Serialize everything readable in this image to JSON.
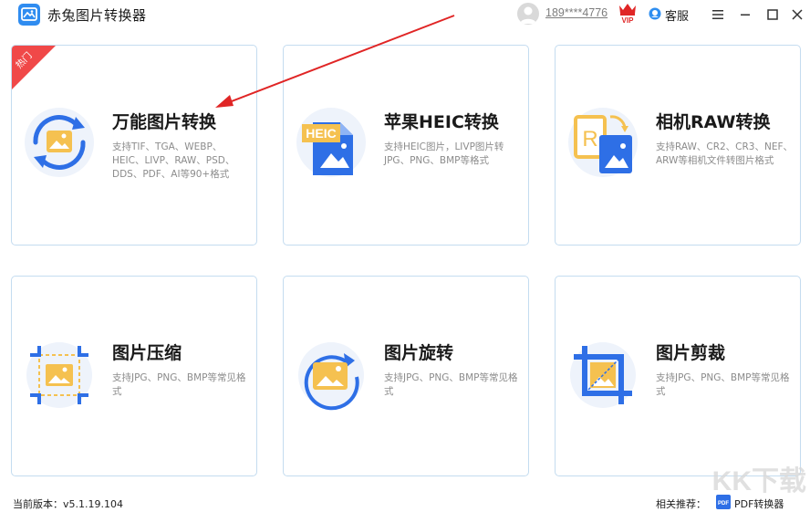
{
  "app": {
    "title": "赤兔图片转换器"
  },
  "header": {
    "phone": "189****4776",
    "vip": "VIP",
    "service_label": "客服"
  },
  "cards": [
    {
      "title": "万能图片转换",
      "desc": "支持TIF、TGA、WEBP、HEIC、LIVP、RAW、PSD、DDS、PDF、AI等90+格式",
      "badge": "热门"
    },
    {
      "title": "苹果HEIC转换",
      "desc": "支持HEIC图片，LIVP图片转JPG、PNG、BMP等格式",
      "icon_text": "HEIC"
    },
    {
      "title": "相机RAW转换",
      "desc": "支持RAW、CR2、CR3、NEF、ARW等相机文件转图片格式",
      "icon_text": "R"
    },
    {
      "title": "图片压缩",
      "desc": "支持JPG、PNG、BMP等常见格式"
    },
    {
      "title": "图片旋转",
      "desc": "支持JPG、PNG、BMP等常见格式"
    },
    {
      "title": "图片剪裁",
      "desc": "支持JPG、PNG、BMP等常见格式"
    }
  ],
  "footer": {
    "version": "当前版本：v5.1.19.104",
    "recommend_label": "相关推荐：",
    "pdf_icon_text": "PDF",
    "pdf_label": "PDF转换器"
  },
  "watermark": "KK下载",
  "colors": {
    "accent": "#2e6fe6",
    "yellow": "#f5c150",
    "card_border": "#c4dcf0",
    "hot": "#f04848"
  }
}
